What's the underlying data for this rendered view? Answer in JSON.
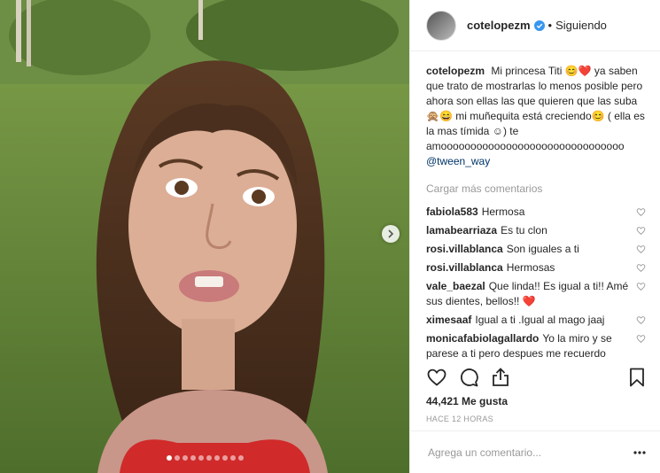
{
  "header": {
    "username": "cotelopezm",
    "separator": "•",
    "follow_state": "Siguiendo"
  },
  "caption": {
    "username": "cotelopezm",
    "text": "Mi princesa Titi 😊❤️ ya saben que trato de mostrarlas lo menos posible pero ahora son ellas las que quieren que las suba 🙊😄 mi muñequita está creciendo😊 ( ella es la mas tímida ☺) te amooooooooooooooooooooooooooooooo",
    "mention": "@tween_way"
  },
  "load_more_label": "Cargar más comentarios",
  "comments": [
    {
      "user": "fabiola583",
      "text": "Hermosa"
    },
    {
      "user": "lamabearriaza",
      "text": "Es tu clon"
    },
    {
      "user": "rosi.villablanca",
      "text": "Son iguales a ti"
    },
    {
      "user": "rosi.villablanca",
      "text": "Hermosas"
    },
    {
      "user": "vale_baezal",
      "text": "Que linda!! Es igual a ti!! Amé sus dientes, bellos!! ❤️"
    },
    {
      "user": "ximesaaf",
      "text": "Igual a ti .Igual al mago jaaj"
    },
    {
      "user": "monicafabiolagallardo",
      "text": "Yo la miro y se parese a ti pero despues me recuerdo"
    }
  ],
  "likes_text": "44,421 Me gusta",
  "time_text": "HACE 12 HORAS",
  "add_comment": {
    "placeholder": "Agrega un comentario..."
  },
  "carousel": {
    "count": 10,
    "active_index": 0
  },
  "colors": {
    "accent": "#3897f0",
    "like_heart": "#ed4956",
    "muted": "#999999",
    "link": "#003569"
  }
}
